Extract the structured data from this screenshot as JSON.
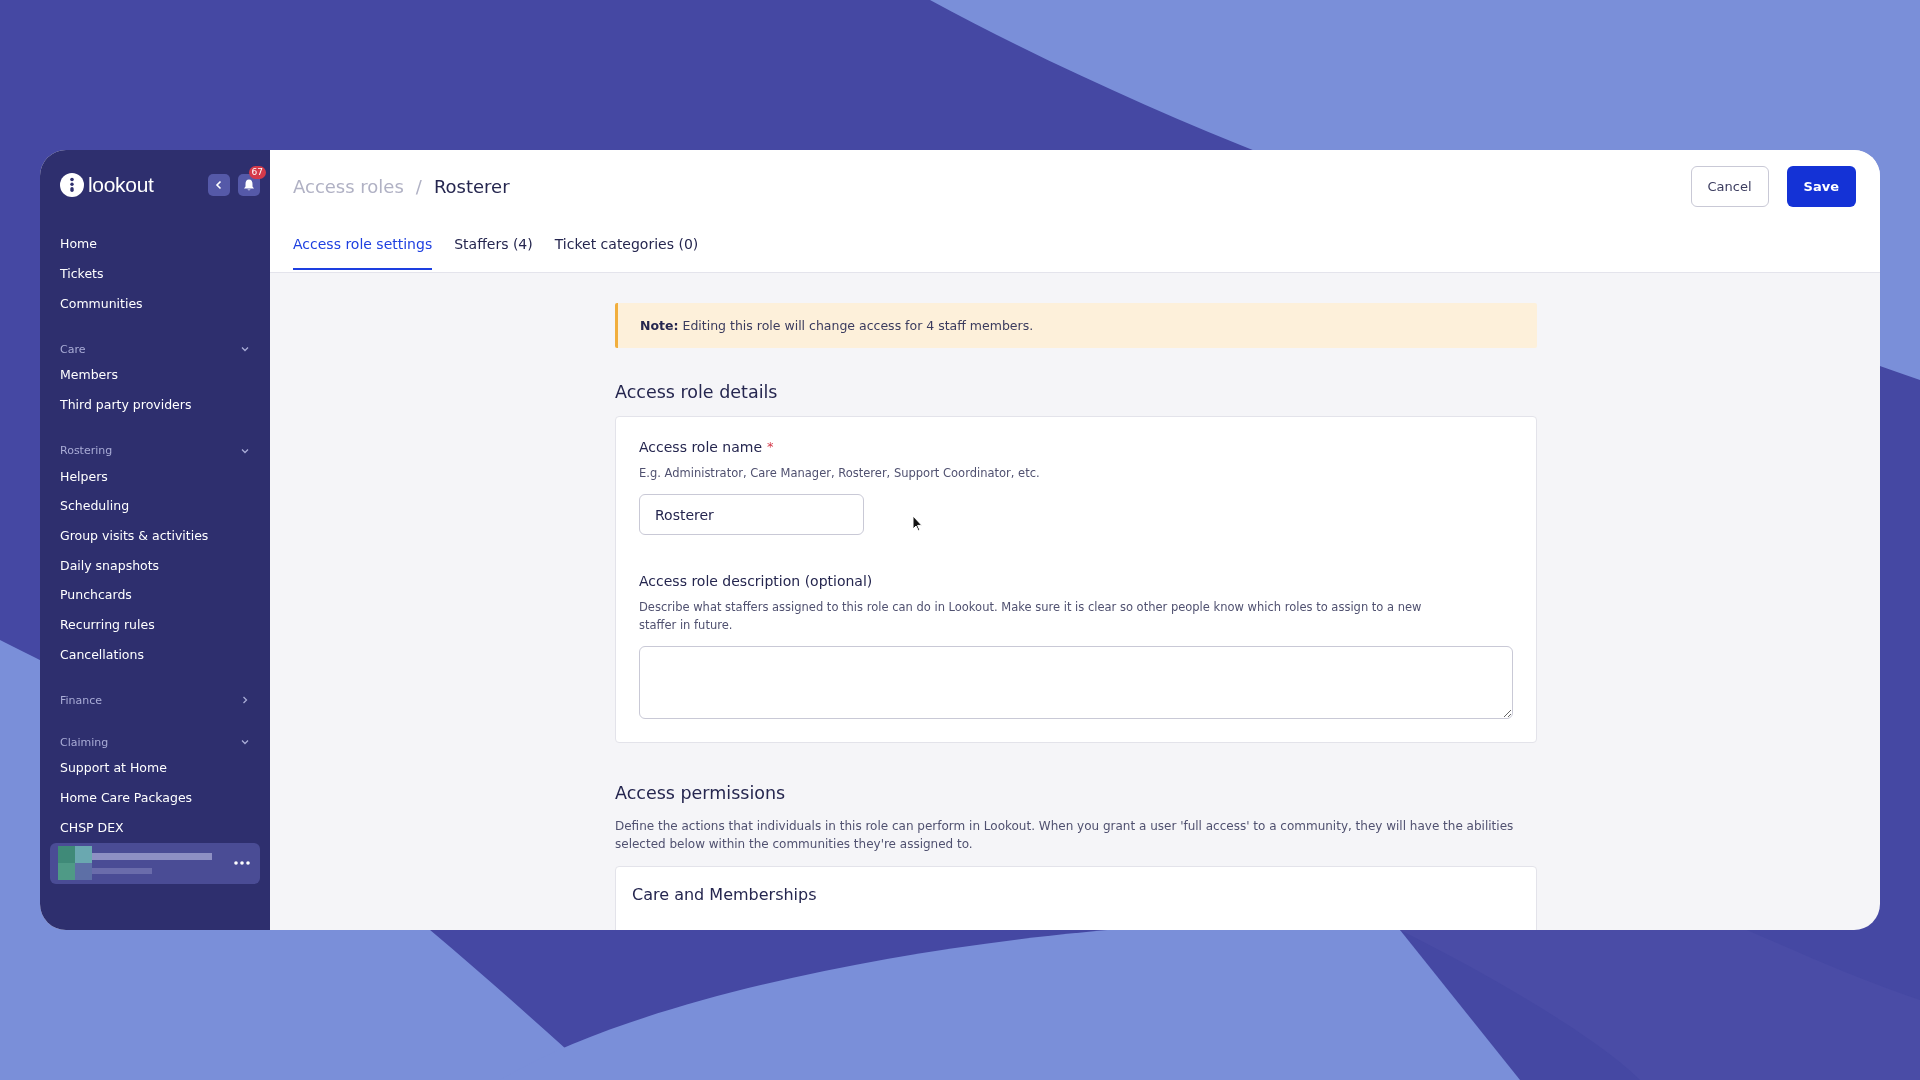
{
  "sidebar": {
    "logo": "lookout",
    "notification_count": "67",
    "nav": [
      {
        "kind": "item",
        "label": "Home"
      },
      {
        "kind": "item",
        "label": "Tickets"
      },
      {
        "kind": "item",
        "label": "Communities"
      },
      {
        "kind": "section",
        "label": "Care",
        "expanded": true
      },
      {
        "kind": "item",
        "label": "Members"
      },
      {
        "kind": "item",
        "label": "Third party providers"
      },
      {
        "kind": "section",
        "label": "Rostering",
        "expanded": true
      },
      {
        "kind": "item",
        "label": "Helpers"
      },
      {
        "kind": "item",
        "label": "Scheduling"
      },
      {
        "kind": "item",
        "label": "Group visits & activities"
      },
      {
        "kind": "item",
        "label": "Daily snapshots"
      },
      {
        "kind": "item",
        "label": "Punchcards"
      },
      {
        "kind": "item",
        "label": "Recurring rules"
      },
      {
        "kind": "item",
        "label": "Cancellations"
      },
      {
        "kind": "section",
        "label": "Finance",
        "expanded": false
      },
      {
        "kind": "section",
        "label": "Claiming",
        "expanded": true
      },
      {
        "kind": "item",
        "label": "Support at Home"
      },
      {
        "kind": "item",
        "label": "Home Care Packages"
      },
      {
        "kind": "item",
        "label": "CHSP DEX"
      }
    ]
  },
  "breadcrumb": {
    "parent": "Access roles",
    "separator": "/",
    "current": "Rosterer"
  },
  "buttons": [
    {
      "kind": "secondary",
      "label": "Cancel"
    },
    {
      "kind": "primary",
      "label": "Save"
    }
  ],
  "tabs": [
    {
      "label": "Access role settings",
      "selected": true
    },
    {
      "label": "Staffers (4)",
      "selected": false
    },
    {
      "label": "Ticket categories (0)",
      "selected": false
    }
  ],
  "note": "**Note:** Editing this role will change access for 4 staff members.",
  "details": {
    "title": "Access role details",
    "name_field": {
      "label": "Access role name",
      "required_mark": "*",
      "hint": "E.g. Administrator, Care Manager, Rosterer, Support Coordinator, etc.",
      "value": "Rosterer"
    },
    "description_field": {
      "label": "Access role description (optional)",
      "hint": "Describe what staffers assigned to this role can do in Lookout. Make sure it is clear so other people know which roles to assign to a new staffer in future."
    }
  },
  "permissions": {
    "title": "Access permissions",
    "description": "Define the actions that individuals in this role can perform in Lookout. When you grant a user 'full access' to a community, they will have the abilities selected below within the communities they're assigned to.",
    "groups": [
      {
        "title": "Care and Memberships"
      }
    ]
  }
}
